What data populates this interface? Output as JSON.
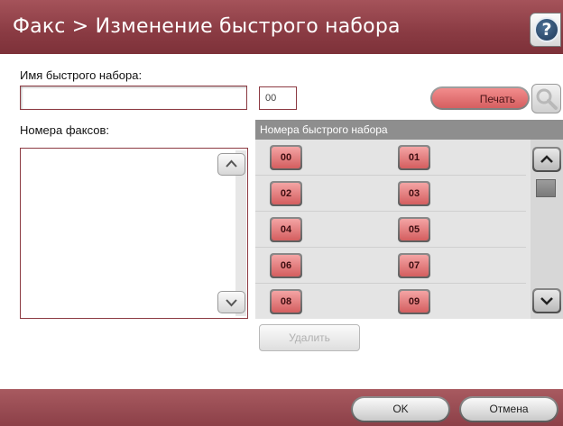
{
  "header": {
    "title": "Факс > Изменение быстрого набора",
    "help_glyph": "?",
    "colors": {
      "bar": "#8a3b43",
      "accent_button": "#d55f60"
    }
  },
  "form": {
    "name_label": "Имя быстрого набора:",
    "name_value": "",
    "number_value": "00",
    "fax_numbers_label": "Номера факсов:",
    "fax_numbers": []
  },
  "toolbar": {
    "print_label": "Печать",
    "search_icon": "magnifier-icon"
  },
  "speed_dial": {
    "header": "Номера быстрого набора",
    "rows": [
      {
        "left": "00",
        "right": "01"
      },
      {
        "left": "02",
        "right": "03"
      },
      {
        "left": "04",
        "right": "05"
      },
      {
        "left": "06",
        "right": "07"
      },
      {
        "left": "08",
        "right": "09"
      }
    ]
  },
  "actions": {
    "delete_label": "Удалить",
    "ok_label": "OK",
    "cancel_label": "Отмена"
  }
}
